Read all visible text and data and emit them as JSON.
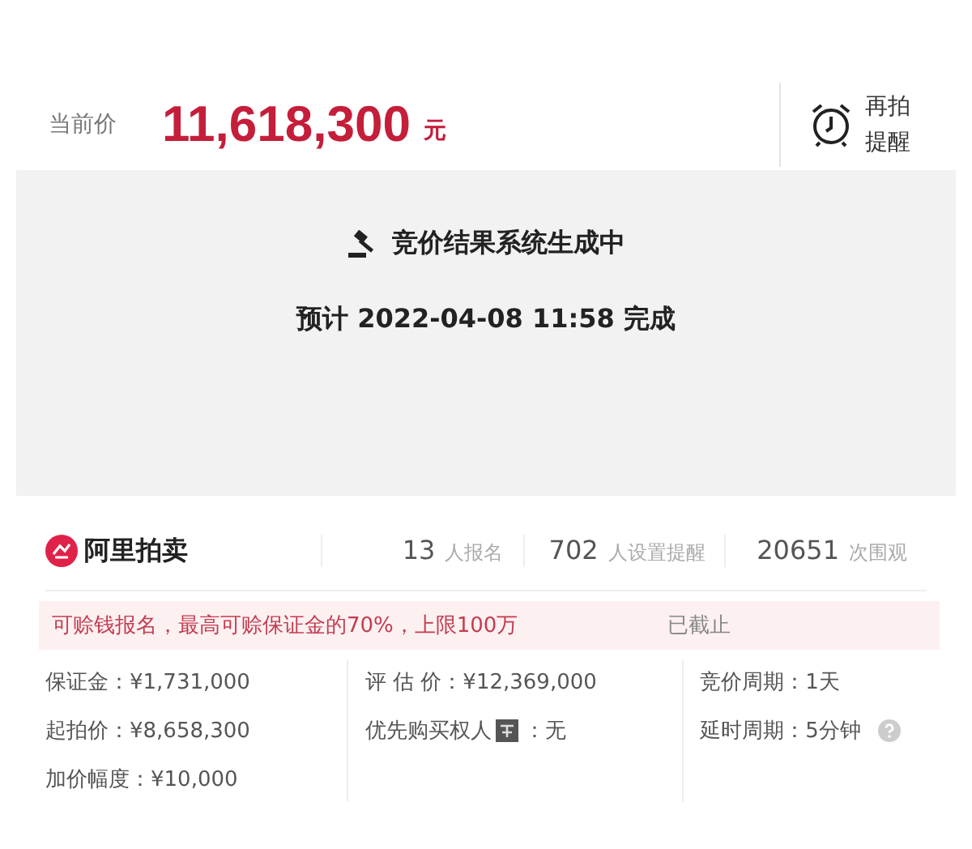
{
  "price": {
    "label": "当前价",
    "value": "11,618,300",
    "unit": "元"
  },
  "reminder": {
    "lines": [
      "再拍",
      "提醒"
    ]
  },
  "status": {
    "title": "竞价结果系统生成中",
    "eta": "预计 2022-04-08 11:58 完成"
  },
  "platform": {
    "name": "阿里拍卖"
  },
  "stats": [
    {
      "count": "13",
      "label": "人报名"
    },
    {
      "count": "702",
      "label": "人设置提醒"
    },
    {
      "count": "20651",
      "label": "次围观"
    }
  ],
  "loan_notice": {
    "text": "可赊钱报名，最高可赊保证金的70%，上限100万",
    "status": "已截止"
  },
  "details": [
    [
      {
        "kind": "plain",
        "text": "保证金：¥1,731,000"
      },
      {
        "kind": "plain",
        "text": "起拍价：¥8,658,300"
      },
      {
        "kind": "plain",
        "text": "加价幅度：¥10,000"
      }
    ],
    [
      {
        "kind": "plain",
        "text": "评 估 价：¥12,369,000"
      },
      {
        "kind": "badge",
        "before": "优先购买权人",
        "after": "：无"
      }
    ],
    [
      {
        "kind": "plain",
        "text": "竞价周期：1天"
      },
      {
        "kind": "help",
        "text": "延时周期：5分钟"
      }
    ]
  ]
}
